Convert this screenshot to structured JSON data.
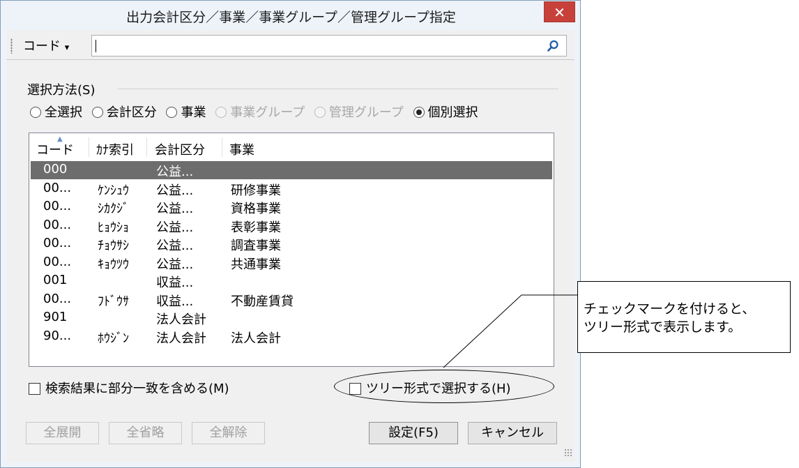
{
  "window": {
    "title": "出力会計区分／事業／事業グループ／管理グループ指定",
    "close_label": "✕"
  },
  "toolbar": {
    "code_label": "コード",
    "dropdown_arrow": "▾",
    "search_value": "",
    "search_icon": "magnifier-icon"
  },
  "selection": {
    "group_label": "選択方法(S)",
    "options": [
      {
        "label": "全選択",
        "checked": false,
        "enabled": true
      },
      {
        "label": "会計区分",
        "checked": false,
        "enabled": true
      },
      {
        "label": "事業",
        "checked": false,
        "enabled": true
      },
      {
        "label": "事業グループ",
        "checked": false,
        "enabled": false
      },
      {
        "label": "管理グループ",
        "checked": false,
        "enabled": false
      },
      {
        "label": "個別選択",
        "checked": true,
        "enabled": true
      }
    ]
  },
  "list": {
    "columns": [
      "コード",
      "ｶﾅ索引",
      "会計区分",
      "事業"
    ],
    "rows": [
      {
        "code": "000",
        "kana": "",
        "kubun": "公益...",
        "jigyo": "",
        "selected": true
      },
      {
        "code": "00...",
        "kana": "ｹﾝｼｭｳ",
        "kubun": "公益...",
        "jigyo": "研修事業",
        "selected": false
      },
      {
        "code": "00...",
        "kana": "ｼｶｸｼﾞ",
        "kubun": "公益...",
        "jigyo": "資格事業",
        "selected": false
      },
      {
        "code": "00...",
        "kana": "ﾋｮｳｼｮ",
        "kubun": "公益...",
        "jigyo": "表彰事業",
        "selected": false
      },
      {
        "code": "00...",
        "kana": "ﾁｮｳｻｼ",
        "kubun": "公益...",
        "jigyo": "調査事業",
        "selected": false
      },
      {
        "code": "00...",
        "kana": "ｷｮｳﾂｳ",
        "kubun": "公益...",
        "jigyo": "共通事業",
        "selected": false
      },
      {
        "code": "001",
        "kana": "",
        "kubun": "収益...",
        "jigyo": "",
        "selected": false
      },
      {
        "code": "00...",
        "kana": "ﾌﾄﾞｳｻ",
        "kubun": "収益...",
        "jigyo": "不動産賃貸",
        "selected": false
      },
      {
        "code": "901",
        "kana": "",
        "kubun": "法人会計",
        "jigyo": "",
        "selected": false
      },
      {
        "code": "90...",
        "kana": "ﾎｳｼﾞﾝ",
        "kubun": "法人会計",
        "jigyo": "法人会計",
        "selected": false
      }
    ]
  },
  "options": {
    "partial_match_label": "検索結果に部分一致を含める(M)",
    "tree_select_label": "ツリー形式で選択する(H)"
  },
  "buttons": {
    "expand_all": "全展開",
    "collapse_all": "全省略",
    "clear_all": "全解除",
    "ok": "設定(F5)",
    "cancel": "キャンセル"
  },
  "callout": {
    "line1": "チェックマークを付けると、",
    "line2": "ツリー形式で表示します。"
  }
}
